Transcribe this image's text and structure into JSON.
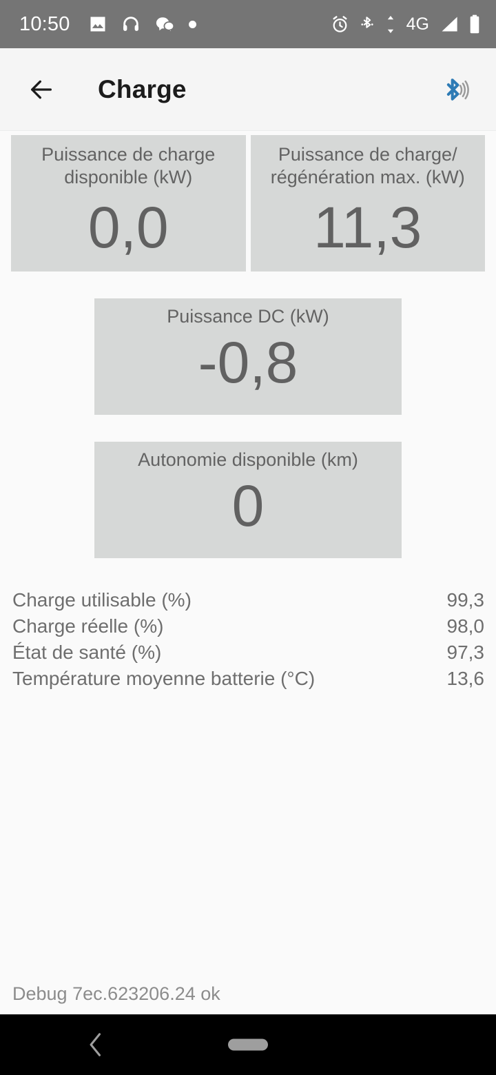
{
  "status_bar": {
    "time": "10:50",
    "network_label": "4G",
    "left_icons": [
      "image-icon",
      "headphones-icon",
      "chat-bubble-icon",
      "dot-icon"
    ],
    "right_icons": [
      "alarm-icon",
      "bluetooth-icon",
      "data-transfer-icon",
      "signal-icon",
      "battery-icon"
    ],
    "background": "#757575"
  },
  "app_bar": {
    "back_label": "back-arrow",
    "title": "Charge",
    "bluetooth_icon": "bluetooth-connected-icon",
    "bluetooth_color": "#2e7bb5",
    "background": "#f5f5f5"
  },
  "cards": {
    "available_charge_power": {
      "label": "Puissance de charge\ndisponible (kW)",
      "value": "0,0"
    },
    "max_charge_regen_power": {
      "label": "Puissance de charge/\nrégénération max. (kW)",
      "value": "11,3"
    },
    "dc_power": {
      "label": "Puissance DC (kW)",
      "value": "-0,8"
    },
    "available_range": {
      "label": "Autonomie disponible (km)",
      "value": "0"
    },
    "background": "#d6d8d7",
    "label_color": "#636363",
    "value_color": "#616161"
  },
  "list": {
    "rows": [
      {
        "label": "Charge utilisable (%)",
        "value": "99,3"
      },
      {
        "label": "Charge réelle (%)",
        "value": "98,0"
      },
      {
        "label": "État de santé (%)",
        "value": "97,3"
      },
      {
        "label": "Température moyenne batterie (°C)",
        "value": "13,6"
      }
    ]
  },
  "debug": {
    "text": "Debug 7ec.623206.24 ok"
  },
  "nav_bar": {
    "back_icon": "chevron-left-icon",
    "home_icon": "home-pill-icon",
    "background": "#000000"
  }
}
